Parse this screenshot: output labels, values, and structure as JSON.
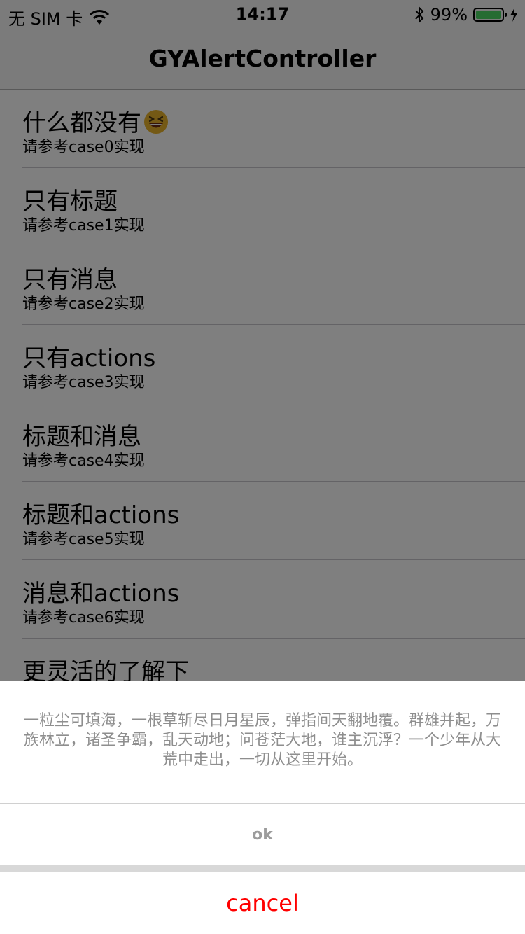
{
  "status_bar": {
    "carrier": "无 SIM 卡",
    "time": "14:17",
    "battery": "99%",
    "battery_level": 0.99,
    "battery_color": "#4cd964"
  },
  "nav": {
    "title": "GYAlertController"
  },
  "cells": [
    {
      "title": "什么都没有",
      "subtitle": "请参考case0实现",
      "emoji": "laughing-face-icon"
    },
    {
      "title": "只有标题",
      "subtitle": "请参考case1实现"
    },
    {
      "title": "只有消息",
      "subtitle": "请参考case2实现"
    },
    {
      "title": "只有actions",
      "subtitle": "请参考case3实现"
    },
    {
      "title": "标题和消息",
      "subtitle": "请参考case4实现"
    },
    {
      "title": "标题和actions",
      "subtitle": "请参考case5实现"
    },
    {
      "title": "消息和actions",
      "subtitle": "请参考case6实现"
    },
    {
      "title": "更灵活的了解下",
      "subtitle": ""
    }
  ],
  "alert": {
    "message": "一粒尘可填海，一根草斩尽日月星辰，弹指间天翻地覆。群雄并起，万族林立，诸圣争霸，乱天动地；问苍茫大地，谁主沉浮？一个少年从大荒中走出，一切从这里开始。",
    "ok_label": "ok",
    "cancel_label": "cancel",
    "cancel_color": "#ff0000"
  }
}
